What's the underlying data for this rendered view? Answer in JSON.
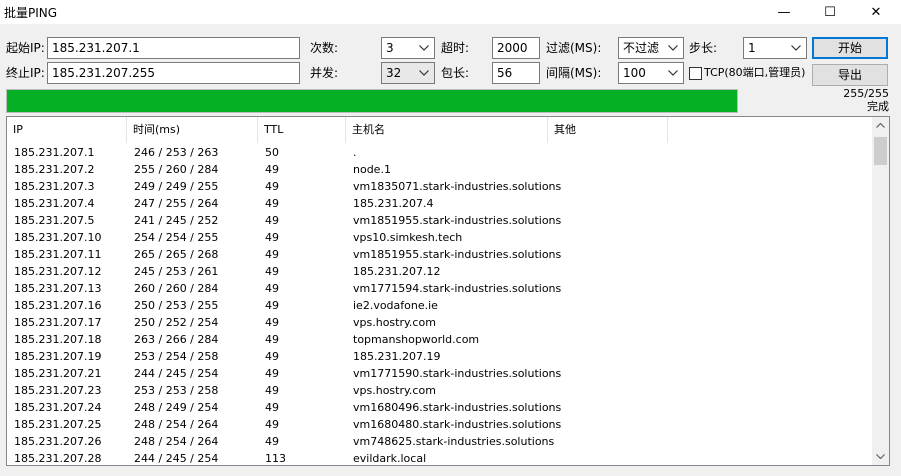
{
  "window": {
    "title": "批量PING",
    "minimize_glyph": "—",
    "maximize_glyph": "☐",
    "close_glyph": "✕"
  },
  "form": {
    "start_ip_label": "起始IP:",
    "start_ip_value": "185.231.207.1",
    "end_ip_label": "终止IP:",
    "end_ip_value": "185.231.207.255",
    "count_label": "次数:",
    "count_value": "3",
    "concurrency_label": "并发:",
    "concurrency_value": "32",
    "timeout_label": "超时:",
    "timeout_value": "2000",
    "packet_label": "包长:",
    "packet_value": "56",
    "filter_label": "过滤(MS):",
    "filter_value": "不过滤",
    "interval_label": "间隔(MS):",
    "interval_value": "100",
    "step_label": "步长:",
    "step_value": "1",
    "tcp_label": "TCP(80端口,管理员)",
    "tcp_checked": false,
    "start_button": "开始",
    "export_button": "导出"
  },
  "progress": {
    "fraction": 1.0,
    "count_text": "255/255",
    "status_text": "完成",
    "fill_color": "#06b025"
  },
  "table": {
    "columns": [
      "IP",
      "时间(ms)",
      "TTL",
      "主机名",
      "其他"
    ],
    "rows": [
      {
        "ip": "185.231.207.1",
        "time": "246 / 253 / 263",
        "ttl": "50",
        "host": ".",
        "other": ""
      },
      {
        "ip": "185.231.207.2",
        "time": "255 / 260 / 284",
        "ttl": "49",
        "host": "node.1",
        "other": ""
      },
      {
        "ip": "185.231.207.3",
        "time": "249 / 249 / 255",
        "ttl": "49",
        "host": "vm1835071.stark-industries.solutions",
        "other": ""
      },
      {
        "ip": "185.231.207.4",
        "time": "247 / 255 / 264",
        "ttl": "49",
        "host": "185.231.207.4",
        "other": ""
      },
      {
        "ip": "185.231.207.5",
        "time": "241 / 245 / 252",
        "ttl": "49",
        "host": "vm1851955.stark-industries.solutions",
        "other": ""
      },
      {
        "ip": "185.231.207.10",
        "time": "254 / 254 / 255",
        "ttl": "49",
        "host": "vps10.simkesh.tech",
        "other": ""
      },
      {
        "ip": "185.231.207.11",
        "time": "265 / 265 / 268",
        "ttl": "49",
        "host": "vm1851955.stark-industries.solutions",
        "other": ""
      },
      {
        "ip": "185.231.207.12",
        "time": "245 / 253 / 261",
        "ttl": "49",
        "host": "185.231.207.12",
        "other": ""
      },
      {
        "ip": "185.231.207.13",
        "time": "260 / 260 / 284",
        "ttl": "49",
        "host": "vm1771594.stark-industries.solutions",
        "other": ""
      },
      {
        "ip": "185.231.207.16",
        "time": "250 / 253 / 255",
        "ttl": "49",
        "host": "ie2.vodafone.ie",
        "other": ""
      },
      {
        "ip": "185.231.207.17",
        "time": "250 / 252 / 254",
        "ttl": "49",
        "host": "vps.hostry.com",
        "other": ""
      },
      {
        "ip": "185.231.207.18",
        "time": "263 / 266 / 284",
        "ttl": "49",
        "host": "topmanshopworld.com",
        "other": ""
      },
      {
        "ip": "185.231.207.19",
        "time": "253 / 254 / 258",
        "ttl": "49",
        "host": "185.231.207.19",
        "other": ""
      },
      {
        "ip": "185.231.207.21",
        "time": "244 / 245 / 254",
        "ttl": "49",
        "host": "vm1771590.stark-industries.solutions",
        "other": ""
      },
      {
        "ip": "185.231.207.23",
        "time": "253 / 253 / 258",
        "ttl": "49",
        "host": "vps.hostry.com",
        "other": ""
      },
      {
        "ip": "185.231.207.24",
        "time": "248 / 249 / 254",
        "ttl": "49",
        "host": "vm1680496.stark-industries.solutions",
        "other": ""
      },
      {
        "ip": "185.231.207.25",
        "time": "248 / 254 / 264",
        "ttl": "49",
        "host": "vm1680480.stark-industries.solutions",
        "other": ""
      },
      {
        "ip": "185.231.207.26",
        "time": "248 / 254 / 264",
        "ttl": "49",
        "host": "vm748625.stark-industries.solutions",
        "other": ""
      },
      {
        "ip": "185.231.207.28",
        "time": "244 / 245 / 254",
        "ttl": "113",
        "host": "evildark.local",
        "other": ""
      }
    ]
  }
}
